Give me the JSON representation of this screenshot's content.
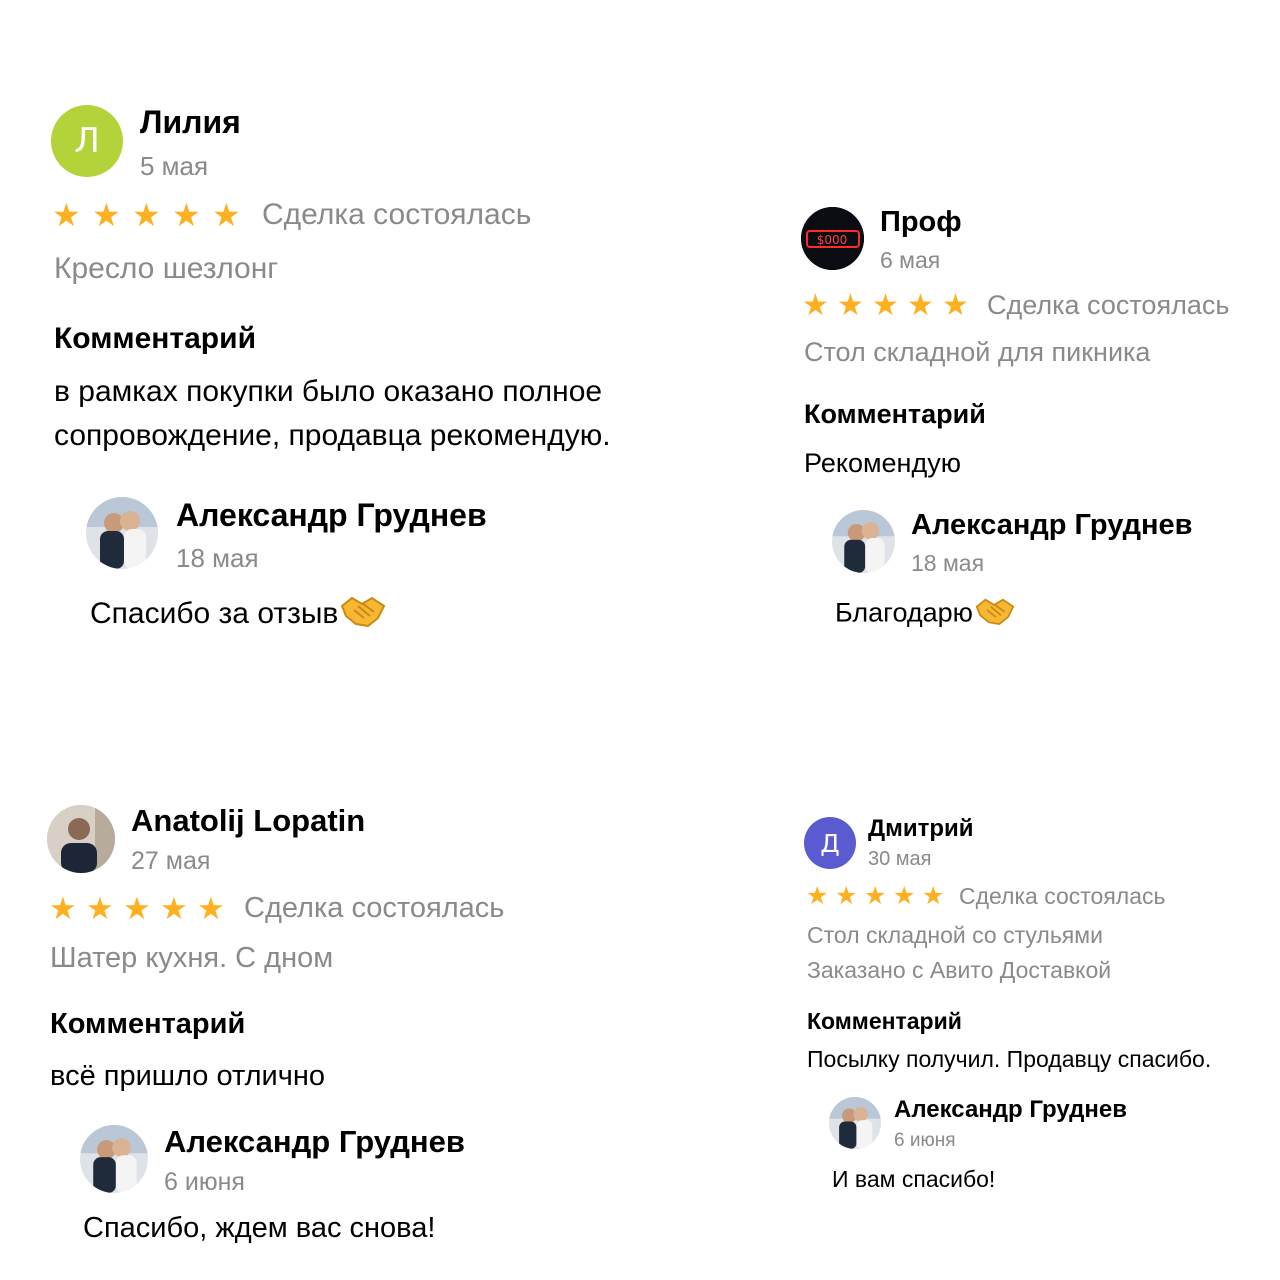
{
  "reviews": [
    {
      "author": "Лилия",
      "avatar_letter": "Л",
      "avatar_color": "#b4d33a",
      "date": "5 мая",
      "rating": 5,
      "deal_status": "Сделка состоялась",
      "product": "Кресло шезлонг",
      "comment_title": "Комментарий",
      "comment": "в рамках покупки было оказано полное сопровождение, продавца рекомендую.",
      "reply": {
        "author": "Александр Груднев",
        "date": "18 мая",
        "text": "Спасибо за отзыв",
        "emoji": "handshake-icon"
      }
    },
    {
      "author": "Проф",
      "avatar_icon": "neon-sign-avatar",
      "date": "6 мая",
      "rating": 5,
      "deal_status": "Сделка состоялась",
      "product": "Стол складной для пикника",
      "comment_title": "Комментарий",
      "comment": "Рекомендую",
      "reply": {
        "author": "Александр Груднев",
        "date": "18 мая",
        "text": "Благодарю",
        "emoji": "handshake-icon"
      }
    },
    {
      "author": "Anatolij Lopatin",
      "avatar_icon": "photo-avatar",
      "date": "27 мая",
      "rating": 5,
      "deal_status": "Сделка состоялась",
      "product": "Шатер кухня. С дном",
      "comment_title": "Комментарий",
      "comment": "всё пришло отлично",
      "reply": {
        "author": "Александр Груднев",
        "date": "6 июня",
        "text": "Спасибо, ждем вас снова!"
      }
    },
    {
      "author": "Дмитрий",
      "avatar_letter": "Д",
      "avatar_color": "#5b5bd1",
      "date": "30 мая",
      "rating": 5,
      "deal_status": "Сделка состоялась",
      "product": "Стол складной со стульями",
      "delivery": "Заказано с Авито Доставкой",
      "comment_title": "Комментарий",
      "comment": "Посылку получил. Продавцу спасибо.",
      "reply": {
        "author": "Александр Груднев",
        "date": "6 июня",
        "text": "И вам спасибо!"
      }
    }
  ],
  "colors": {
    "star": "#ffb021",
    "muted": "#8a8a8a",
    "text": "#000000"
  }
}
